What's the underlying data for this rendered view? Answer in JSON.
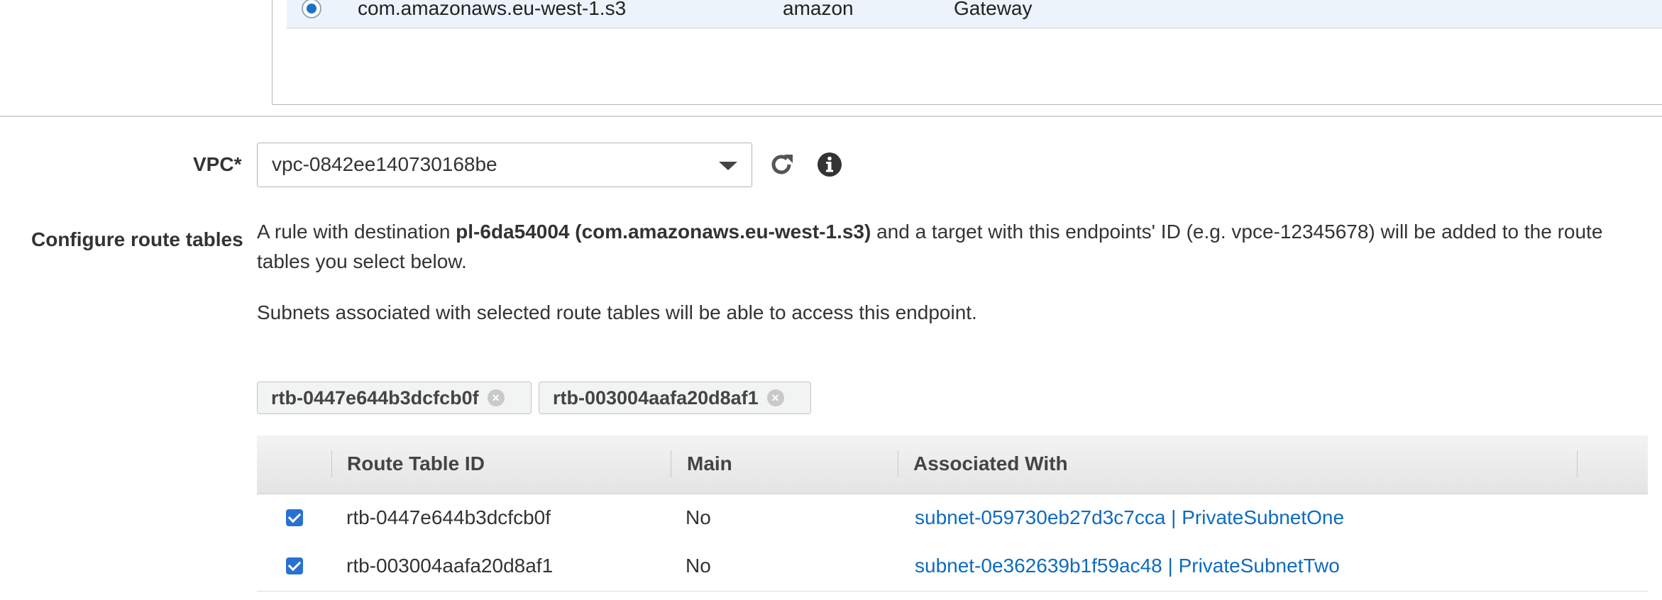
{
  "service_table": {
    "selected_row": {
      "service_name": "com.amazonaws.eu-west-1.s3",
      "owner": "amazon",
      "type": "Gateway"
    }
  },
  "vpc": {
    "label": "VPC*",
    "selected_value": "vpc-0842ee140730168be",
    "refresh_icon": "refresh-icon",
    "info_icon": "info-icon"
  },
  "route_tables": {
    "label": "Configure route tables",
    "rule_text_prefix": "A rule with destination",
    "rule_text_bold": "pl-6da54004 (com.amazonaws.eu-west-1.s3)",
    "rule_text_suffix": "and a target with this endpoints' ID (e.g. vpce-12345678) will be added to the route tables you select below.",
    "subnet_note": "Subnets associated with selected route tables will be able to access this endpoint.",
    "tokens": [
      {
        "label": "rtb-0447e644b3dcfcb0f"
      },
      {
        "label": "rtb-003004aafa20d8af1"
      }
    ],
    "columns": [
      "Route Table ID",
      "Main",
      "Associated With"
    ],
    "rows": [
      {
        "checked": true,
        "id": "rtb-0447e644b3dcfcb0f",
        "main": "No",
        "associated": "subnet-059730eb27d3c7cca | PrivateSubnetOne"
      },
      {
        "checked": true,
        "id": "rtb-003004aafa20d8af1",
        "main": "No",
        "associated": "subnet-0e362639b1f59ac48 | PrivateSubnetTwo"
      }
    ]
  },
  "colors": {
    "accent": "#0f6bbf",
    "checkbox": "#2a72cf",
    "selected_row_bg": "#edf3fb"
  }
}
